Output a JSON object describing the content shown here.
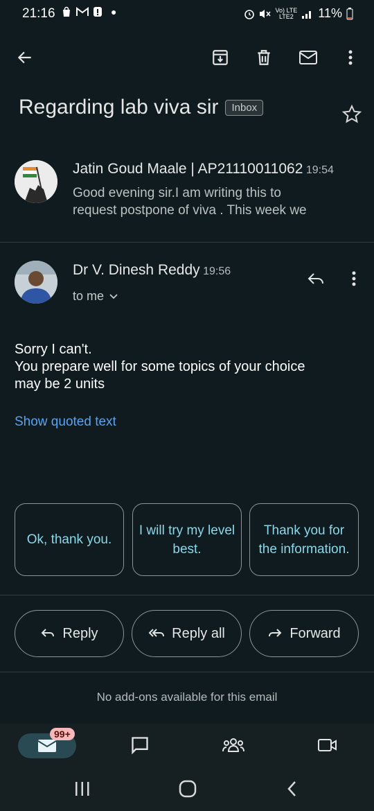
{
  "status_bar": {
    "time": "21:16",
    "network": "Vo) LTE",
    "network_sub": "LTE2",
    "battery": "11%"
  },
  "toolbar": {
    "icons": [
      "back-arrow-icon",
      "archive-icon",
      "delete-icon",
      "mail-icon",
      "more-vert-icon"
    ]
  },
  "subject": {
    "title": "Regarding lab viva sir",
    "label": "Inbox"
  },
  "messages": [
    {
      "sender": "Jatin Goud Maale | AP21110011062",
      "time": "19:54",
      "snippet_line1": "Good evening sir.I am writing this to",
      "snippet_line2": "request postpone of viva . This week we"
    },
    {
      "sender": "Dr V. Dinesh Reddy",
      "time": "19:56",
      "recipient": "to me",
      "body_line1": "Sorry I can't.",
      "body_line2": "You prepare well for some topics of your choice",
      "body_line3": "may be 2 units",
      "quoted_link": "Show quoted text"
    }
  ],
  "smart_replies": [
    "Ok, thank you.",
    "I will try my level best.",
    "Thank you for the information."
  ],
  "actions": {
    "reply": "Reply",
    "reply_all": "Reply all",
    "forward": "Forward"
  },
  "addons_text": "No add-ons available for this email",
  "bottom_nav": {
    "mail_badge": "99+",
    "items": [
      "mail-icon",
      "chat-icon",
      "spaces-icon",
      "meet-icon"
    ]
  },
  "colors": {
    "background": "#0f1b1e",
    "accent_link": "#5aa3f0",
    "smart_reply_text": "#8ad8ea",
    "badge": "#f6b8b8"
  }
}
